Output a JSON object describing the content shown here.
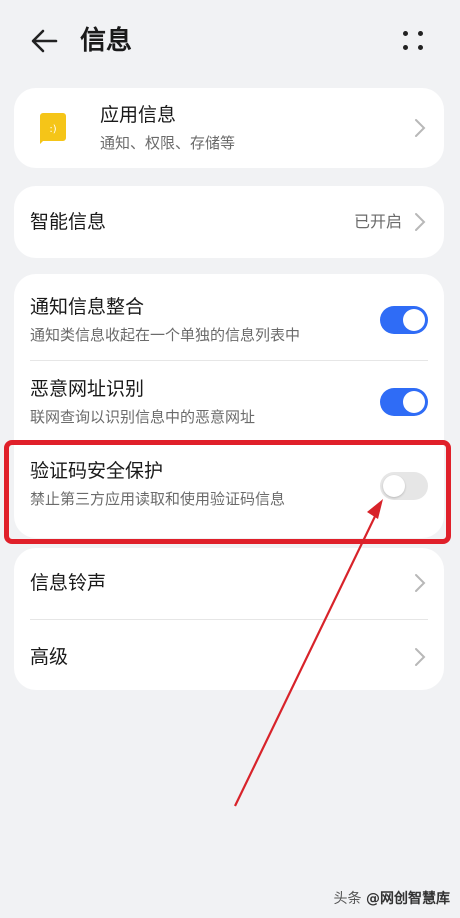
{
  "header": {
    "title": "信息"
  },
  "app_info": {
    "label": "应用信息",
    "sub": "通知、权限、存储等"
  },
  "smart": {
    "label": "智能信息",
    "value": "已开启"
  },
  "settings": [
    {
      "label": "通知信息整合",
      "sub": "通知类信息收起在一个单独的信息列表中",
      "enabled": true
    },
    {
      "label": "恶意网址识别",
      "sub": "联网查询以识别信息中的恶意网址",
      "enabled": true
    },
    {
      "label": "验证码安全保护",
      "sub": "禁止第三方应用读取和使用验证码信息",
      "enabled": false
    }
  ],
  "more_items": [
    {
      "label": "信息铃声"
    },
    {
      "label": "高级"
    }
  ],
  "watermark": {
    "prefix": "头条",
    "handle": "@网创智慧库"
  },
  "colors": {
    "accent": "#2f6cf6",
    "highlight": "#e0202a",
    "app_icon": "#f5c518"
  },
  "icons": {
    "back": "arrow-left-icon",
    "more": "more-dots-icon",
    "chevron": "chevron-right-icon",
    "app": "message-app-icon"
  }
}
